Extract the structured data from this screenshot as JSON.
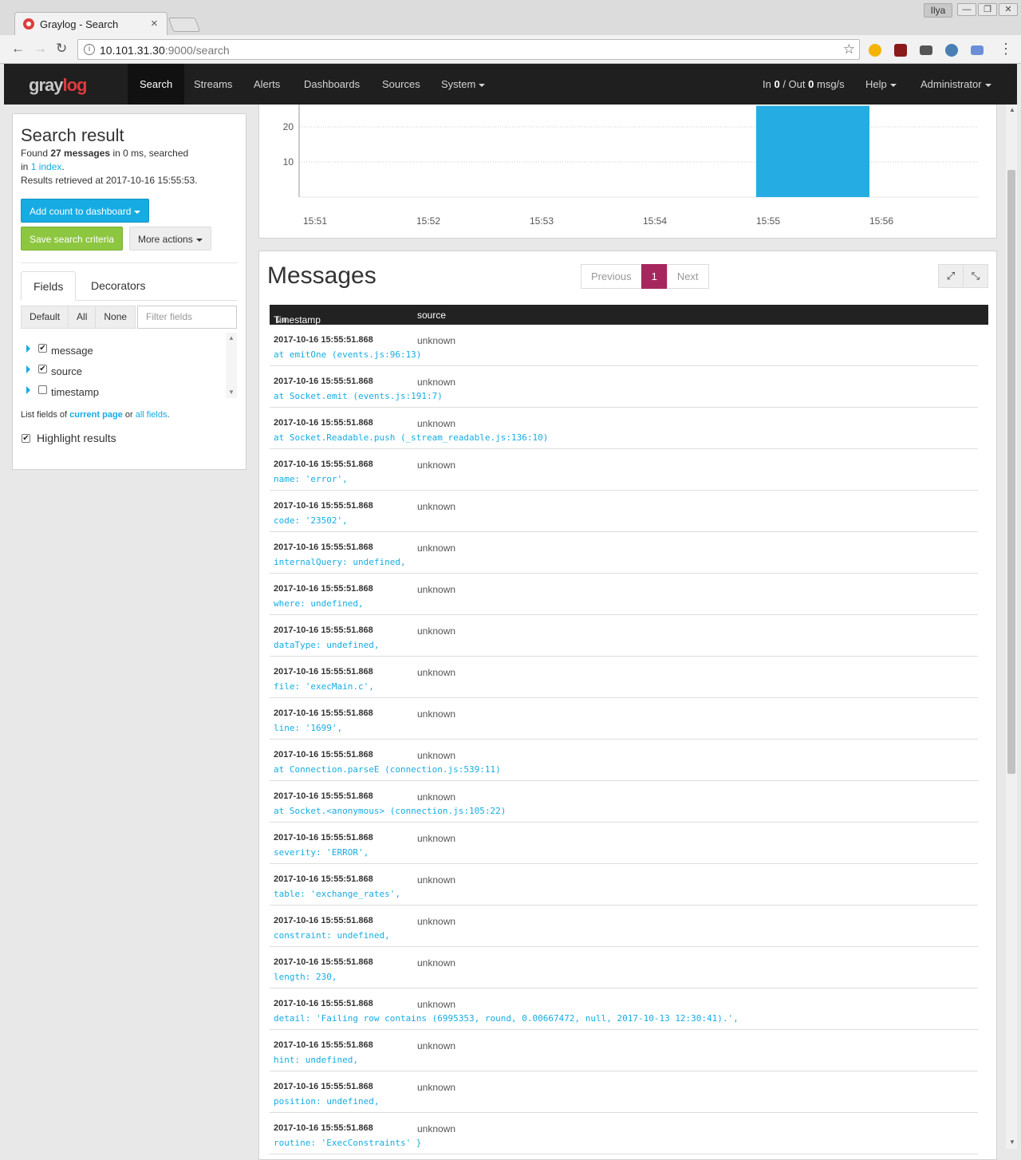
{
  "browser": {
    "tab_title": "Graylog - Search",
    "tab_close": "×",
    "url_host": "10.101.31.30",
    "url_rest": ":9000/search",
    "user_label": "Ilya",
    "min": "—",
    "restore": "❐",
    "close": "✕",
    "back": "←",
    "forward": "→",
    "reload": "↻",
    "star": "☆",
    "info": "i"
  },
  "nav": {
    "logo_gray": "gray",
    "logo_log": "log",
    "items": [
      "Search",
      "Streams",
      "Alerts",
      "Dashboards",
      "Sources",
      "System"
    ],
    "throughput_in_label": "In",
    "throughput_in": "0",
    "throughput_sep": "/ Out",
    "throughput_out": "0",
    "throughput_unit": "msg/s",
    "help": "Help",
    "admin": "Administrator"
  },
  "sidebar": {
    "title": "Search result",
    "found_pre": "Found",
    "found_count": "27 messages",
    "found_post": "in 0 ms, searched",
    "in_pre": "in",
    "index_link": "1 index",
    "in_post": ".",
    "retrieved": "Results retrieved at 2017-10-16 15:55:53.",
    "add_count": "Add count to dashboard",
    "save_search": "Save search criteria",
    "more_actions": "More actions",
    "tab_fields": "Fields",
    "tab_decorators": "Decorators",
    "btn_default": "Default",
    "btn_all": "All",
    "btn_none": "None",
    "filter_placeholder": "Filter fields",
    "fields": [
      {
        "name": "message",
        "checked": "✔"
      },
      {
        "name": "source",
        "checked": "✔"
      },
      {
        "name": "timestamp",
        "checked": ""
      }
    ],
    "list_pre": "List fields of",
    "current_page": "current page",
    "list_or": "or",
    "all_fields": "all fields",
    "list_post": ".",
    "highlight": "Highlight results",
    "highlight_checked": "✔"
  },
  "chart_data": {
    "type": "bar",
    "x_ticks": [
      "15:51",
      "15:52",
      "15:53",
      "15:54",
      "15:55",
      "15:56"
    ],
    "y_ticks": [
      10,
      20
    ],
    "bars": [
      {
        "x_start": "15:55",
        "x_end": "15:56",
        "value": 27
      }
    ],
    "y_visible_max": 26,
    "bar_color": "#24ace3"
  },
  "messages": {
    "title": "Messages",
    "prev": "Previous",
    "page": "1",
    "next": "Next",
    "expand": "⤢",
    "collapse": "⤡",
    "col_timestamp": "Timestamp",
    "col_source": "source",
    "rows": [
      {
        "ts": "2017-10-16 15:55:51.868",
        "src": "unknown",
        "msg": "at emitOne (events.js:96:13)"
      },
      {
        "ts": "2017-10-16 15:55:51.868",
        "src": "unknown",
        "msg": "at Socket.emit (events.js:191:7)"
      },
      {
        "ts": "2017-10-16 15:55:51.868",
        "src": "unknown",
        "msg": "at Socket.Readable.push (_stream_readable.js:136:10)"
      },
      {
        "ts": "2017-10-16 15:55:51.868",
        "src": "unknown",
        "msg": "name: 'error',"
      },
      {
        "ts": "2017-10-16 15:55:51.868",
        "src": "unknown",
        "msg": "code: '23502',"
      },
      {
        "ts": "2017-10-16 15:55:51.868",
        "src": "unknown",
        "msg": "internalQuery: undefined,"
      },
      {
        "ts": "2017-10-16 15:55:51.868",
        "src": "unknown",
        "msg": "where: undefined,"
      },
      {
        "ts": "2017-10-16 15:55:51.868",
        "src": "unknown",
        "msg": "dataType: undefined,"
      },
      {
        "ts": "2017-10-16 15:55:51.868",
        "src": "unknown",
        "msg": "file: 'execMain.c',"
      },
      {
        "ts": "2017-10-16 15:55:51.868",
        "src": "unknown",
        "msg": "line: '1699',"
      },
      {
        "ts": "2017-10-16 15:55:51.868",
        "src": "unknown",
        "msg": "at Connection.parseE (connection.js:539:11)"
      },
      {
        "ts": "2017-10-16 15:55:51.868",
        "src": "unknown",
        "msg": "at Socket.<anonymous> (connection.js:105:22)"
      },
      {
        "ts": "2017-10-16 15:55:51.868",
        "src": "unknown",
        "msg": "severity: 'ERROR',"
      },
      {
        "ts": "2017-10-16 15:55:51.868",
        "src": "unknown",
        "msg": "table: 'exchange_rates',"
      },
      {
        "ts": "2017-10-16 15:55:51.868",
        "src": "unknown",
        "msg": "constraint: undefined,"
      },
      {
        "ts": "2017-10-16 15:55:51.868",
        "src": "unknown",
        "msg": "length: 230,"
      },
      {
        "ts": "2017-10-16 15:55:51.868",
        "src": "unknown",
        "msg": "detail: 'Failing row contains (6995353, round, 0.00667472, null, 2017-10-13 12:30:41).',"
      },
      {
        "ts": "2017-10-16 15:55:51.868",
        "src": "unknown",
        "msg": "hint: undefined,"
      },
      {
        "ts": "2017-10-16 15:55:51.868",
        "src": "unknown",
        "msg": "position: undefined,"
      },
      {
        "ts": "2017-10-16 15:55:51.868",
        "src": "unknown",
        "msg": "routine: 'ExecConstraints' }"
      }
    ]
  }
}
